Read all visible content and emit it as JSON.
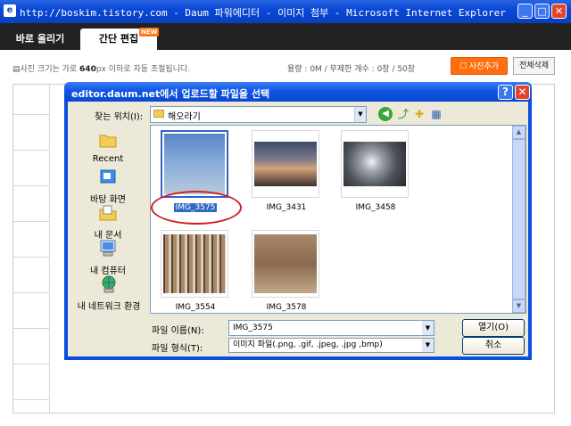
{
  "window": {
    "title": "http://boskim.tistory.com - Daum 파워에디터 - 이미지 첨부 - Microsoft Internet Explorer",
    "icon": "e",
    "minimize": "_",
    "maximize": "□",
    "close": "✕"
  },
  "tabs": [
    {
      "label": "바로 올리기",
      "active": false
    },
    {
      "label": "간단 편집",
      "active": true,
      "badge": "NEW"
    }
  ],
  "editor": {
    "size_note_pre": "▤사진 크기는 가로 ",
    "size_note_bold": "640",
    "size_note_post": "px 이하로 자동 조절됩니다.",
    "stats": "용량 : 0M / 무제한  개수 : 0장 / 50장",
    "add_photo_label": "☐ 사진추가",
    "delete_all_label": "전체삭제"
  },
  "dialog": {
    "title": "editor.daum.net에서 업로드할 파일을 선택",
    "help": "?",
    "close": "✕",
    "look_in_label": "찾는 위치(I):",
    "look_in_value": "해오라기",
    "toolbar_icons": [
      "back-icon",
      "up-folder-icon",
      "new-folder-icon",
      "views-menu-icon"
    ],
    "places": [
      {
        "label": "Recent",
        "icon": "recent-folder-icon"
      },
      {
        "label": "바탕 화면",
        "icon": "desktop-icon"
      },
      {
        "label": "내 문서",
        "icon": "my-documents-icon"
      },
      {
        "label": "내 컴퓨터",
        "icon": "my-computer-icon"
      },
      {
        "label": "내 네트워크 환경",
        "icon": "network-icon"
      }
    ],
    "files": [
      {
        "name": "IMG_3575",
        "selected": true
      },
      {
        "name": "IMG_3431",
        "selected": false
      },
      {
        "name": "IMG_3458",
        "selected": false
      },
      {
        "name": "IMG_3554",
        "selected": false
      },
      {
        "name": "IMG_3578",
        "selected": false
      }
    ],
    "filename_label": "파일 이름(N):",
    "filename_value": "IMG_3575",
    "filetype_label": "파일 형식(T):",
    "filetype_value": "이미지 파일(.png, .gif, .jpeg, .jpg ,bmp)",
    "open_label": "열기(O)",
    "cancel_label": "취소"
  },
  "colors": {
    "titlebar": "#0a48d8",
    "accent_orange": "#ff6f0f",
    "selection": "#316ac5",
    "annotation_red": "#d02020"
  }
}
